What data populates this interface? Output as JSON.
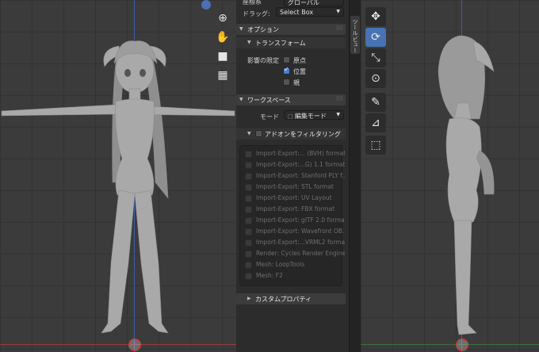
{
  "header": {
    "coord_label": "座標系",
    "coord_value": "グローバル",
    "drag_label": "ドラッグ:",
    "drag_value": "Select Box"
  },
  "panel": {
    "options_title": "オプション",
    "transform_title": "トランスフォーム",
    "affect_only_label": "影響の限定",
    "checks": [
      {
        "label": "原点",
        "checked": false
      },
      {
        "label": "位置",
        "checked": true
      },
      {
        "label": "親",
        "checked": false
      }
    ],
    "workspace_title": "ワークスペース",
    "mode_label": "モード",
    "mode_value": "編集モード",
    "addon_filter_label": "アドオンをフィルタリング",
    "addons": [
      "Import-Export:... (BVH) format",
      "Import-Export:...G) 1.1 format",
      "Import-Export: Stanford PLY f...",
      "Import-Export: STL format",
      "Import-Export: UV Layout",
      "Import-Export: FBX format",
      "Import-Export: glTF 2.0 format",
      "Import-Export: Wavefront OB...",
      "Import-Export:...VRML2 format",
      "Render: Cycles Render Engine",
      "Mesh: LoopTools",
      "Mesh: F2"
    ],
    "custom_props_title": "カスタムプロパティ"
  },
  "side_tab": {
    "label": "ツール",
    "label2": "ビュー"
  },
  "nav_icons": [
    "zoom-icon",
    "hand-icon",
    "camera-icon",
    "grid-icon"
  ],
  "tool_icons": [
    "move-icon",
    "rotate-icon",
    "scale-icon",
    "transform-icon",
    "annotate-icon",
    "measure-icon",
    "add-cube-icon"
  ],
  "colors": {
    "accent": "#4772b3",
    "checkbox_on": "#4a7fd3",
    "axis_blue": "#3f5fa8",
    "axis_red": "#9a3b3b",
    "cursor": "#dd3333"
  }
}
